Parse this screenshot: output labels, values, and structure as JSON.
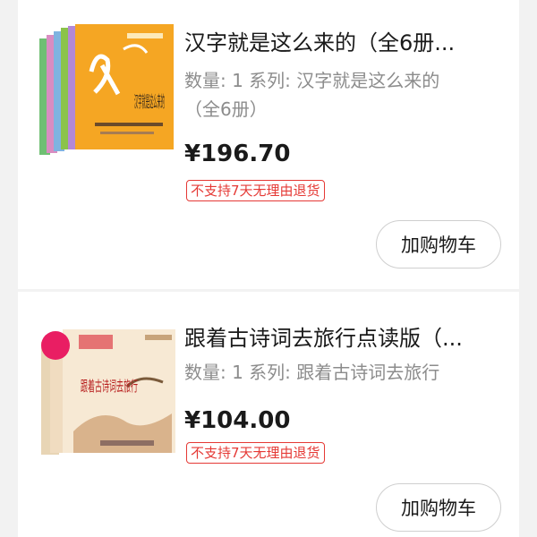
{
  "items": [
    {
      "title": "汉字就是这么来的（全6册...",
      "meta_line1": "数量: 1  系列: 汉字就是这么来的",
      "meta_line2": "（全6册）",
      "price": "¥196.70",
      "badge": "不支持7天无理由退货",
      "button": "加购物车",
      "cover_text": "汉字就是这么来的",
      "cover_color": "#f5a623"
    },
    {
      "title": "跟着古诗词去旅行点读版（...",
      "meta_line1": "数量: 1  系列: 跟着古诗词去旅行",
      "price": "¥104.00",
      "badge": "不支持7天无理由退货",
      "button": "加购物车",
      "cover_text": "跟着古诗词去旅行",
      "cover_color": "#f3e2c8"
    }
  ],
  "colors": {
    "accent": "#e53935",
    "background": "#f2f2f2"
  }
}
